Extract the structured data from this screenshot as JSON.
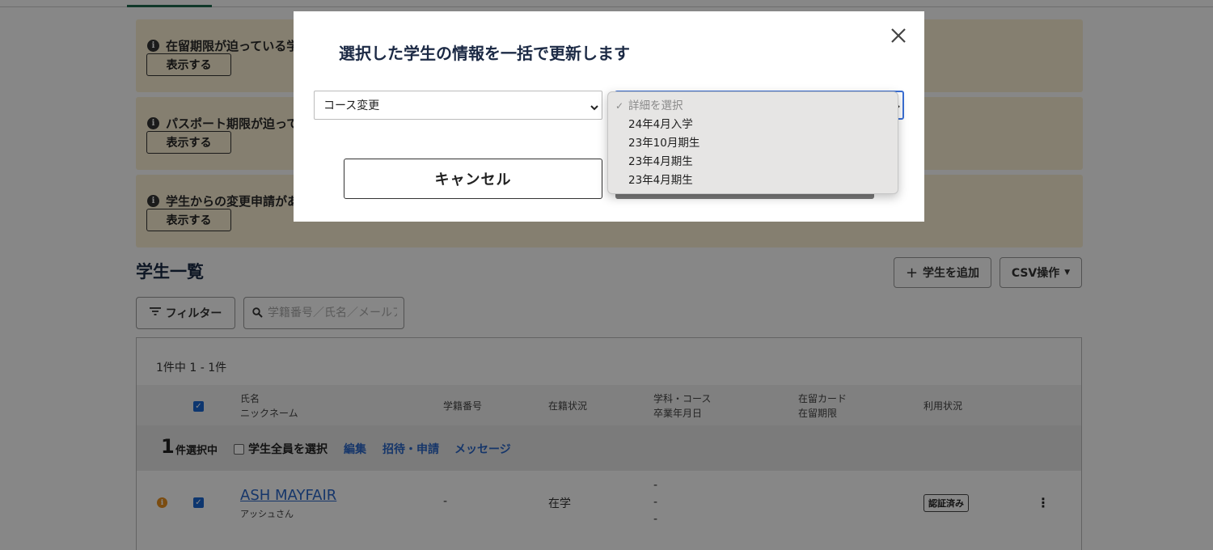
{
  "alerts": [
    {
      "text": "在留期限が迫っている学生",
      "button": "表示する"
    },
    {
      "text": "パスポート期限が迫っている学生",
      "button": "表示する"
    },
    {
      "text": "学生からの変更申請がある学生",
      "button": "表示する"
    }
  ],
  "list": {
    "title": "学生一覧",
    "add_button": "学生を追加",
    "csv_button": "CSV操作",
    "filter_button": "フィルター",
    "search_placeholder": "学籍番号／氏名／メールアドレス",
    "count_text": "1件中  1 - 1件"
  },
  "table": {
    "headers": {
      "name": "氏名",
      "nickname": "ニックネーム",
      "student_id": "学籍番号",
      "enrollment": "在籍状況",
      "course": "学科・コース",
      "graduation": "卒業年月日",
      "residence_card": "在留カード",
      "residence_period": "在留期限",
      "usage": "利用状況"
    },
    "selection": {
      "count": "1",
      "label": "件選択中",
      "select_all": "学生全員を選択",
      "actions": [
        "編集",
        "招待・申請",
        "メッセージ"
      ]
    },
    "rows": [
      {
        "name": "ASH MAYFAIR",
        "nickname": "アッシュさん",
        "student_id": "-",
        "enrollment": "在学",
        "course_lines": [
          "-",
          "-",
          "-"
        ],
        "usage_badge": "認証済み"
      }
    ]
  },
  "modal": {
    "title": "選択した学生の情報を一括で更新します",
    "field_select_value": "コース変更",
    "detail_select_placeholder": "詳細を選択",
    "cancel_button": "キャンセル",
    "dropdown_options": [
      "詳細を選択",
      "24年4月入学",
      "23年10月期生",
      "23年4月期生",
      "23年4月期生"
    ]
  }
}
